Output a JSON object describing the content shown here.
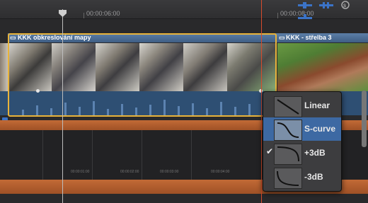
{
  "ruler": {
    "timecodes": [
      "00:00:06:00",
      "00:00:08:00"
    ]
  },
  "clips": {
    "primary_title": "KKK obkreslování mapy",
    "secondary_title": "KKK - střelba 3"
  },
  "lanes": {
    "timecodes": [
      "00:00:01:00",
      "00:00:02:00",
      "00:00:03:00",
      "00:00:04:00"
    ]
  },
  "fade_menu": {
    "items": [
      {
        "label": "Linear",
        "selected": false,
        "checked": false
      },
      {
        "label": "S-curve",
        "selected": true,
        "checked": false
      },
      {
        "label": "+3dB",
        "selected": false,
        "checked": true
      },
      {
        "label": "-3dB",
        "selected": false,
        "checked": false
      }
    ],
    "check_glyph": "✔"
  },
  "colors": {
    "clip_outline": "#e8b33a",
    "clip_header": "#4a6e98",
    "audio": "#2e4f73",
    "orange_track": "#b85f2e",
    "menu_bg": "#3d3d3f",
    "menu_selected": "#3d69a3",
    "skimmer": "#d74b2c"
  },
  "icons": [
    "audio-meter-icon",
    "audio-skim-icon",
    "snap-icon",
    "skimming-icon"
  ]
}
